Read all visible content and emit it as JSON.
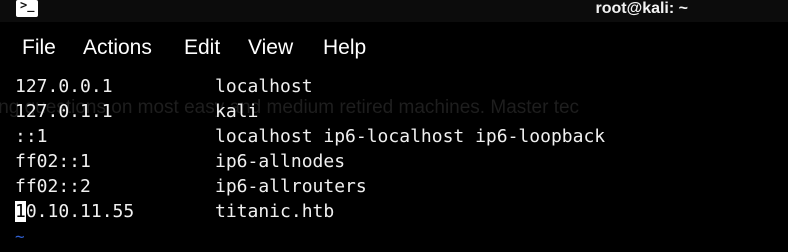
{
  "window": {
    "title": "root@kali: ~",
    "app_icon": "terminal-icon"
  },
  "menubar": {
    "items": [
      {
        "label": "File"
      },
      {
        "label": "Actions"
      },
      {
        "label": "Edit"
      },
      {
        "label": "View"
      },
      {
        "label": "Help"
      }
    ]
  },
  "background_overlay_text": "ing questions on most easy and medium retired machines. Master tec",
  "terminal": {
    "hosts": [
      {
        "ip": "127.0.0.1",
        "names": "localhost"
      },
      {
        "ip": "127.0.1.1",
        "names": "kali"
      },
      {
        "ip": "::1",
        "names": "localhost ip6-localhost ip6-loopback"
      },
      {
        "ip": "ff02::1",
        "names": "ip6-allnodes"
      },
      {
        "ip": "ff02::2",
        "names": "ip6-allrouters"
      },
      {
        "ip_cursor_char": "1",
        "ip_rest": "0.10.11.55",
        "names": "titanic.htb"
      }
    ],
    "empty_line_marker": "~"
  },
  "colors": {
    "background": "#000000",
    "text": "#f0f0f0",
    "tilde": "#2f5fd0"
  }
}
